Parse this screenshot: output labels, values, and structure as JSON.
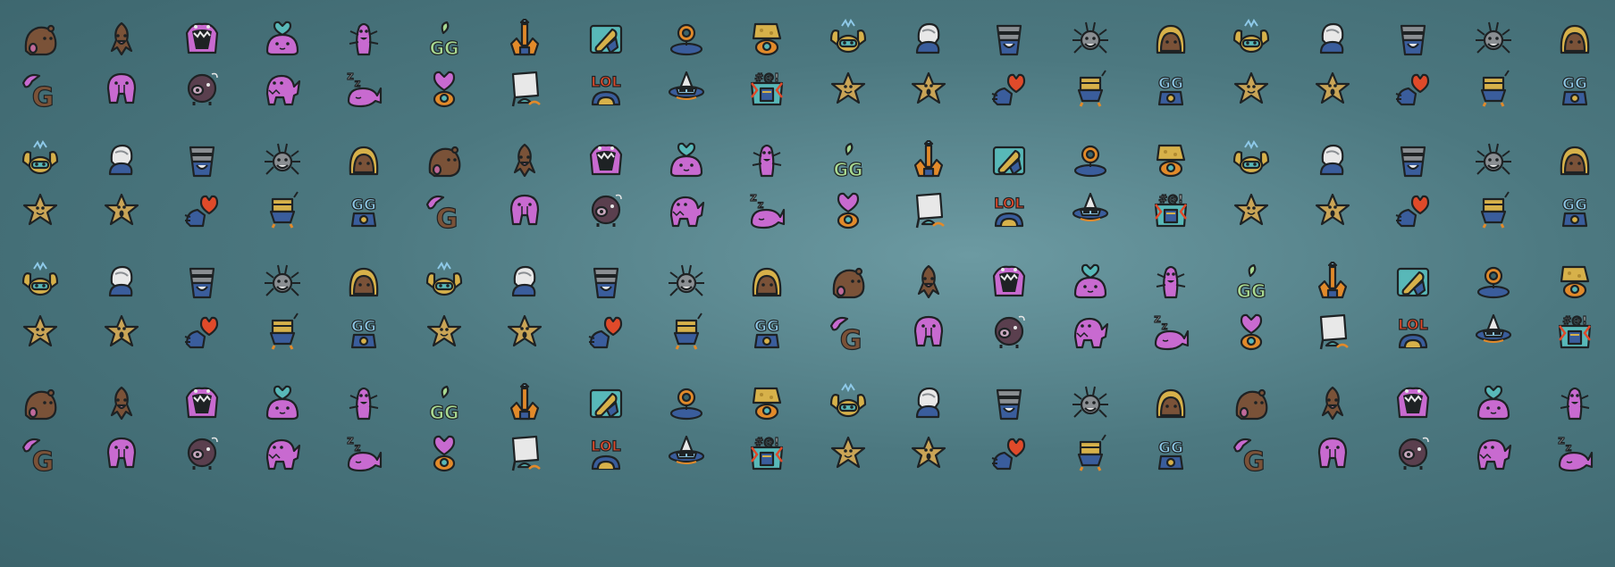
{
  "sheet": {
    "background_colors": [
      "#6c9aa2",
      "#4c7880",
      "#3b646c"
    ],
    "visible_text": [
      "GG",
      "LOL",
      "#@!",
      "ZZ"
    ]
  },
  "icon_sets": {
    "A": [
      "blob-brown-icon",
      "squid-brown-icon",
      "monster-mouth-icon",
      "heart-blob-icon",
      "worm-pink-icon",
      "gg-sprout-icon",
      "castle-orange-icon",
      "bag-blue-icon",
      "ring-portal-icon",
      "cheese-cup-icon",
      "crab-yellow-icon",
      "ghost-helmet-icon",
      "knight-bucket-icon",
      "spider-gray-icon",
      "robot-round-icon",
      "crab-yellow-icon",
      "ghost-helmet-icon",
      "knight-bucket-icon",
      "spider-gray-icon",
      "robot-round-icon"
    ],
    "B": [
      "g-snake-icon",
      "elephant-pink-icon",
      "pig-dark-icon",
      "dino-pink-icon",
      "whale-sleep-icon",
      "heart-pot-icon",
      "flag-castle-icon",
      "lol-sign-icon",
      "ufo-sunglasses-icon",
      "swear-box-icon",
      "star-smile-icon",
      "star-surprised-icon",
      "heart-bird-icon",
      "bee-robot-icon",
      "gg-robot-icon",
      "star-smile-icon",
      "star-surprised-icon",
      "heart-bird-icon",
      "bee-robot-icon",
      "gg-robot-icon"
    ],
    "C": [
      "crab-yellow-icon",
      "ghost-helmet-icon",
      "knight-bucket-icon",
      "spider-gray-icon",
      "robot-round-icon",
      "blob-brown-icon",
      "squid-brown-icon",
      "monster-mouth-icon",
      "heart-blob-icon",
      "worm-pink-icon",
      "gg-sprout-icon",
      "castle-orange-icon",
      "bag-blue-icon",
      "ring-portal-icon",
      "cheese-cup-icon",
      "crab-yellow-icon",
      "ghost-helmet-icon",
      "knight-bucket-icon",
      "spider-gray-icon",
      "robot-round-icon"
    ],
    "D": [
      "star-smile-icon",
      "star-surprised-icon",
      "heart-bird-icon",
      "bee-robot-icon",
      "gg-robot-icon",
      "g-snake-icon",
      "elephant-pink-icon",
      "pig-dark-icon",
      "dino-pink-icon",
      "whale-sleep-icon",
      "heart-pot-icon",
      "flag-castle-icon",
      "lol-sign-icon",
      "ufo-sunglasses-icon",
      "swear-box-icon",
      "star-smile-icon",
      "star-surprised-icon",
      "heart-bird-icon",
      "bee-robot-icon",
      "gg-robot-icon"
    ],
    "E": [
      "crab-yellow-icon",
      "ghost-helmet-icon",
      "knight-bucket-icon",
      "spider-gray-icon",
      "robot-round-icon",
      "crab-yellow-icon",
      "ghost-helmet-icon",
      "knight-bucket-icon",
      "spider-gray-icon",
      "robot-round-icon",
      "blob-brown-icon",
      "squid-brown-icon",
      "monster-mouth-icon",
      "heart-blob-icon",
      "worm-pink-icon",
      "gg-sprout-icon",
      "castle-orange-icon",
      "bag-blue-icon",
      "ring-portal-icon",
      "cheese-cup-icon"
    ],
    "F": [
      "star-smile-icon",
      "star-surprised-icon",
      "heart-bird-icon",
      "bee-robot-icon",
      "gg-robot-icon",
      "star-smile-icon",
      "star-surprised-icon",
      "heart-bird-icon",
      "bee-robot-icon",
      "gg-robot-icon",
      "g-snake-icon",
      "elephant-pink-icon",
      "pig-dark-icon",
      "dino-pink-icon",
      "whale-sleep-icon",
      "heart-pot-icon",
      "flag-castle-icon",
      "lol-sign-icon",
      "ufo-sunglasses-icon",
      "swear-box-icon"
    ],
    "G": [
      "blob-brown-icon",
      "squid-brown-icon",
      "monster-mouth-icon",
      "heart-blob-icon",
      "worm-pink-icon",
      "gg-sprout-icon",
      "castle-orange-icon",
      "bag-blue-icon",
      "ring-portal-icon",
      "cheese-cup-icon",
      "crab-yellow-icon",
      "ghost-helmet-icon",
      "knight-bucket-icon",
      "spider-gray-icon",
      "robot-round-icon",
      "blob-brown-icon",
      "squid-brown-icon",
      "monster-mouth-icon",
      "heart-blob-icon",
      "worm-pink-icon"
    ],
    "H": [
      "g-snake-icon",
      "elephant-pink-icon",
      "pig-dark-icon",
      "dino-pink-icon",
      "whale-sleep-icon",
      "heart-pot-icon",
      "flag-castle-icon",
      "lol-sign-icon",
      "ufo-sunglasses-icon",
      "swear-box-icon",
      "star-smile-icon",
      "star-surprised-icon",
      "heart-bird-icon",
      "bee-robot-icon",
      "gg-robot-icon",
      "g-snake-icon",
      "elephant-pink-icon",
      "pig-dark-icon",
      "dino-pink-icon",
      "whale-sleep-icon"
    ]
  },
  "row_order": [
    "A",
    "B",
    "C",
    "D",
    "E",
    "F",
    "G",
    "H"
  ],
  "palette": {
    "outline": "#1e2224",
    "brown": "#7a5238",
    "pink": "#c86ad0",
    "dark_purple": "#5a3f4e",
    "yellow": "#d7b14a",
    "orange": "#e28a2a",
    "blue": "#3a5d9c",
    "light_blue": "#8ec9e8",
    "gray": "#8a8e92",
    "white": "#e8e8e8",
    "green": "#a8d890",
    "red": "#e04a2a",
    "teal": "#58b8b8",
    "star": "#c9a456"
  }
}
